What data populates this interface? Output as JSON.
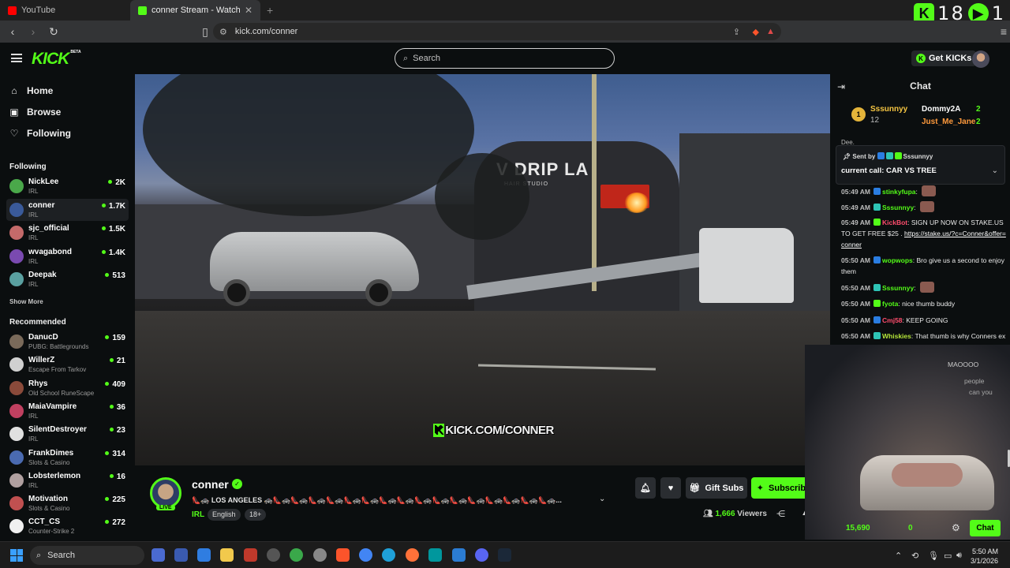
{
  "browser": {
    "tabs": [
      {
        "title": "YouTube",
        "favicon_color": "#ff0000"
      },
      {
        "title": "conner Stream - Watch Live o",
        "favicon_color": "#53fc18",
        "active": true
      }
    ],
    "url": "kick.com/conner",
    "overlay_counter": {
      "left_value": "18",
      "right_value": "1",
      "left_color": "#53fc18",
      "right_color": "#53fc18"
    }
  },
  "header": {
    "logo": "KICK",
    "logo_beta": "BETA",
    "search_placeholder": "Search",
    "get_kicks_label": "Get KICKs"
  },
  "sidebar": {
    "nav": [
      {
        "label": "Home",
        "icon": "home-icon"
      },
      {
        "label": "Browse",
        "icon": "browse-icon"
      },
      {
        "label": "Following",
        "icon": "heart-icon"
      }
    ],
    "following_heading": "Following",
    "following": [
      {
        "name": "NickLee",
        "category": "IRL",
        "viewers": "2K",
        "color": "#4aa84a"
      },
      {
        "name": "conner",
        "category": "IRL",
        "viewers": "1.7K",
        "color": "#3a5a9a",
        "selected": true
      },
      {
        "name": "sjc_official",
        "category": "IRL",
        "viewers": "1.5K",
        "color": "#c46a6a"
      },
      {
        "name": "wvagabond",
        "category": "IRL",
        "viewers": "1.4K",
        "color": "#7a4ab0"
      },
      {
        "name": "Deepak",
        "category": "IRL",
        "viewers": "513",
        "color": "#5aa0a0"
      }
    ],
    "show_more": "Show More",
    "recommended_heading": "Recommended",
    "recommended": [
      {
        "name": "DanucD",
        "category": "PUBG: Battlegrounds",
        "viewers": "159",
        "color": "#7a6a5a"
      },
      {
        "name": "WillerZ",
        "category": "Escape From Tarkov",
        "viewers": "21",
        "color": "#d0d0d0"
      },
      {
        "name": "Rhys",
        "category": "Old School RuneScape",
        "viewers": "409",
        "color": "#8a4a3a"
      },
      {
        "name": "MaiaVampire",
        "category": "IRL",
        "viewers": "36",
        "color": "#c04060"
      },
      {
        "name": "SilentDestroyer",
        "category": "IRL",
        "viewers": "23",
        "color": "#e0e0e0"
      },
      {
        "name": "FrankDimes",
        "category": "Slots & Casino",
        "viewers": "314",
        "color": "#4a6ab0"
      },
      {
        "name": "Lobsterlemon",
        "category": "IRL",
        "viewers": "16",
        "color": "#b0a0a0"
      },
      {
        "name": "Motivation",
        "category": "Slots & Casino",
        "viewers": "225",
        "color": "#c05050"
      },
      {
        "name": "CCT_CS",
        "category": "Counter-Strike 2",
        "viewers": "272",
        "color": "#f0f0f0"
      }
    ]
  },
  "video": {
    "sign_text": "V DRIP LA",
    "sign_sub": "HAIR STUDIO",
    "watermark_k": "K",
    "watermark": "KICK.COM/CONNER"
  },
  "stream": {
    "name": "conner",
    "live_label": "LIVE",
    "title": "👠🚓 LOS ANGELES 🚓👠🚓👠🚓👠🚓👠🚓👠🚓👠🚓👠🚓👠🚓👠🚓👠🚓👠🚓👠🚓👠🚓👠🚓👠🚓👠🚓...",
    "category": "IRL",
    "tags": [
      "English",
      "18+"
    ],
    "gift_subs_label": "Gift Subs",
    "subscribe_label": "Subscribe",
    "viewers_count": "1,666",
    "viewers_label": "Viewers"
  },
  "chat": {
    "title": "Chat",
    "leaderboard": {
      "rank": "1",
      "top_name": "Sssunnyy",
      "top_count": "12",
      "entries": [
        {
          "name": "Dommy2A",
          "count": "2"
        },
        {
          "name": "Just_Me_Jane",
          "count": "2"
        }
      ]
    },
    "partial_top": "Dee.",
    "pinned": {
      "sent_by_label": "Sent by",
      "sent_by": "Sssunnyy",
      "message": "current call: CAR VS TREE"
    },
    "messages": [
      {
        "time": "05:49 AM",
        "user": "stinkyfupa",
        "color": "#53fc18",
        "text": ""
      },
      {
        "time": "05:49 AM",
        "user": "Sssunnyy",
        "color": "#53fc18",
        "text": ""
      },
      {
        "time": "05:49 AM",
        "user": "KickBot",
        "color": "#ff4d6d",
        "text": "SIGN UP NOW ON STAKE.US TO GET FREE $25 .",
        "link": "https://stake.us/?c=Conner&offer=conner"
      },
      {
        "time": "05:50 AM",
        "user": "wopwops",
        "color": "#53fc18",
        "text": "Bro give us a second to enjoy them"
      },
      {
        "time": "05:50 AM",
        "user": "Sssunnyy",
        "color": "#53fc18",
        "text": ""
      },
      {
        "time": "05:50 AM",
        "user": "fyota",
        "color": "#53fc18",
        "text": "nice thumb buddy"
      },
      {
        "time": "05:50 AM",
        "user": "Cmj58",
        "color": "#ff4d6d",
        "text": "KEEP GOING"
      },
      {
        "time": "05:50 AM",
        "user": "Whiskies",
        "color": "#b6e63a",
        "text": "That thumb is why Conners ex left him, didn't want her kids with that"
      }
    ],
    "partial_lines": [
      "MAOOOO",
      "people",
      "can you"
    ],
    "kicks_balance": "15,690",
    "kicks_zero": "0",
    "send_label": "Chat"
  },
  "taskbar": {
    "search_label": "Search",
    "time": "5:50 AM",
    "date": "3/1/2026"
  }
}
